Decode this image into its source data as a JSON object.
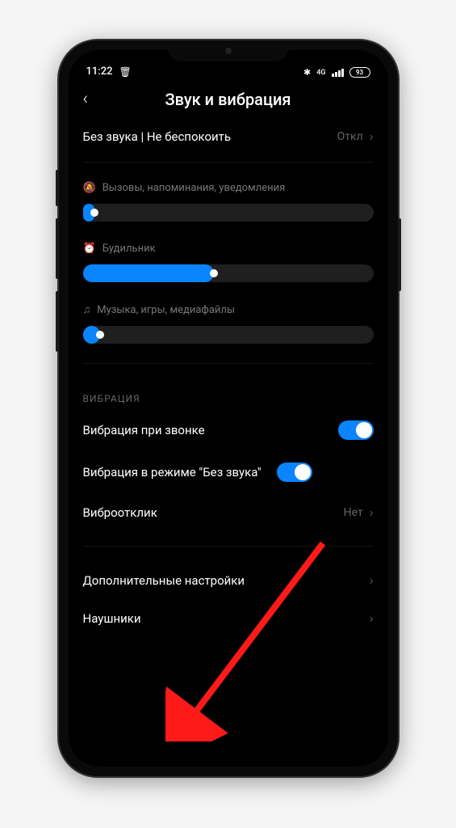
{
  "status_bar": {
    "time": "11:22",
    "net_label": "4G",
    "battery": "93"
  },
  "header": {
    "title": "Звук и вибрация"
  },
  "silent_row": {
    "label": "Без звука | Не беспокоить",
    "value": "Откл"
  },
  "sliders": {
    "calls": {
      "label": "Вызовы, напоминания, уведомления",
      "percent": 4
    },
    "alarm": {
      "label": "Будильник",
      "percent": 45
    },
    "media": {
      "label": "Музыка, игры, медиафайлы",
      "percent": 6
    }
  },
  "vibration_section": {
    "heading": "ВИБРАЦИЯ",
    "vibrate_on_call": {
      "label": "Вибрация при звонке",
      "on": true
    },
    "vibrate_on_silent": {
      "label": "Вибрация в режиме \"Без звука\"",
      "on": true
    },
    "haptic": {
      "label": "Виброотклик",
      "value": "Нет"
    }
  },
  "more": {
    "advanced": "Дополнительные настройки",
    "headphones": "Наушники"
  }
}
